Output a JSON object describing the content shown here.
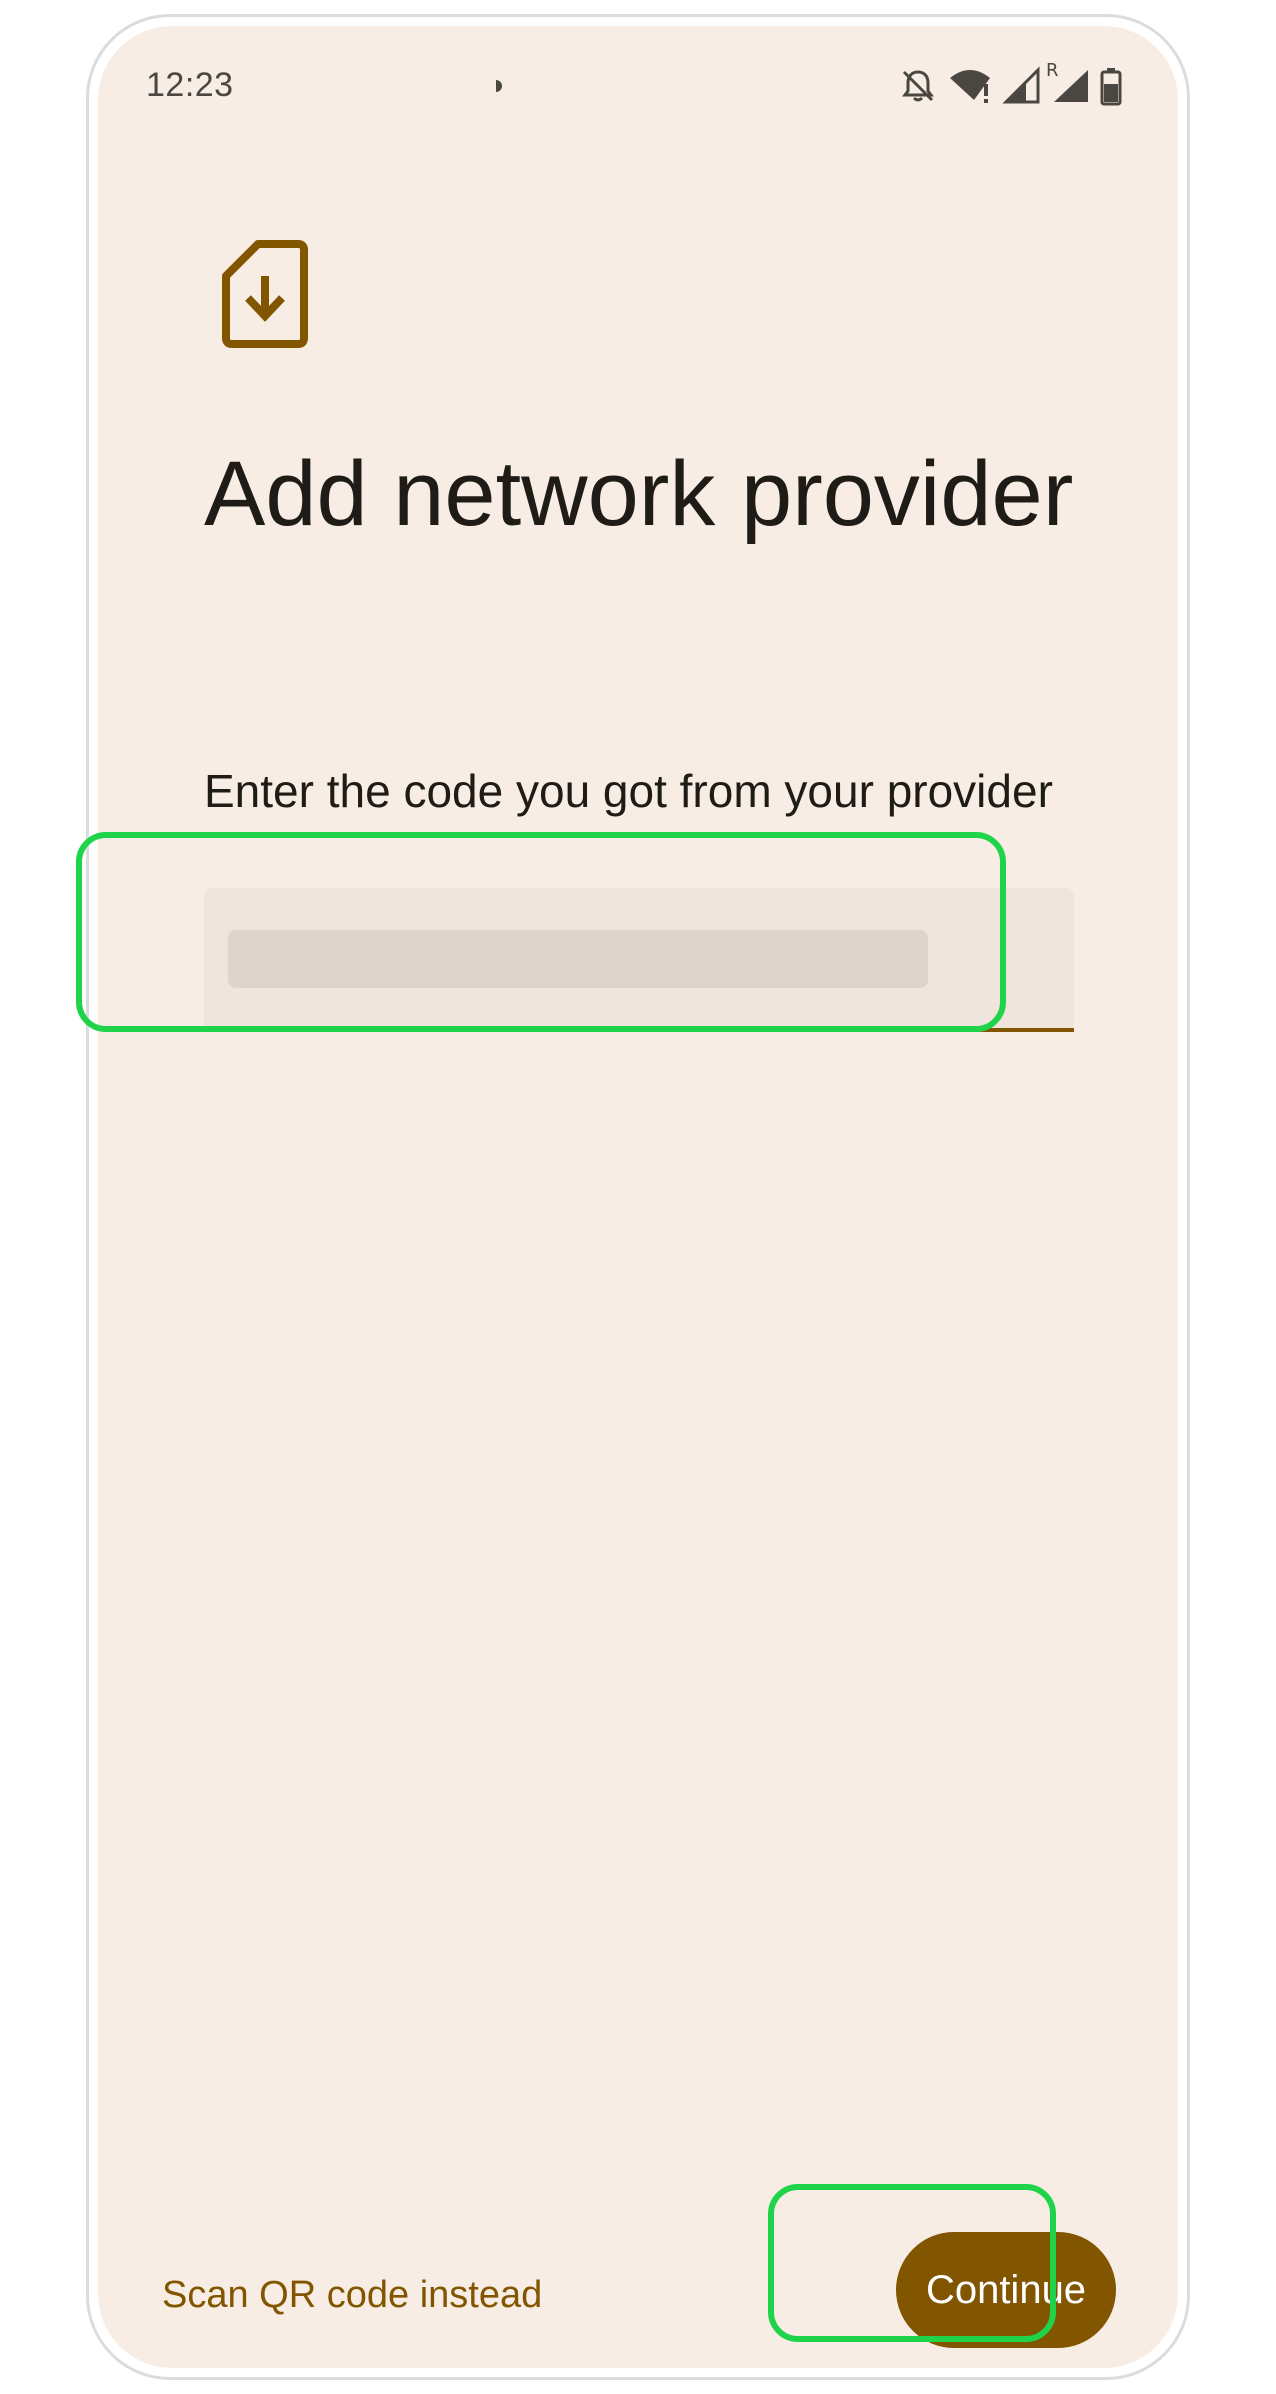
{
  "status_bar": {
    "time": "12:23"
  },
  "icons": {
    "sim_download": "sim-card-download-icon",
    "notifications_off": "bell-off-icon",
    "wifi": "wifi-alert-icon",
    "signal": "cellular-signal-icon",
    "roaming": "roaming-signal-icon",
    "roaming_label": "R",
    "battery": "battery-icon"
  },
  "main": {
    "title": "Add network provider",
    "subtitle": "Enter the code you got from your provider",
    "code_field": {
      "value": "",
      "placeholder": ""
    }
  },
  "footer": {
    "scan_link": "Scan QR code instead",
    "continue_label": "Continue"
  },
  "colors": {
    "background": "#f8ede4",
    "accent": "#825500",
    "field_fill": "#efe5dc",
    "highlight": "#1fd44a",
    "text": "#1f1b16"
  }
}
